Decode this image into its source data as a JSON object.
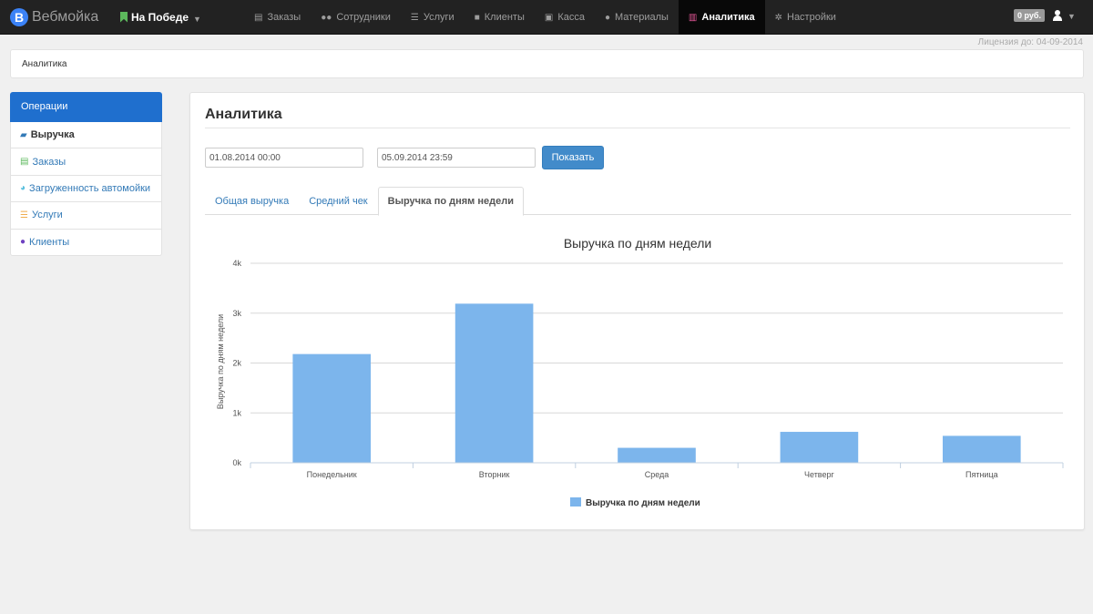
{
  "app": {
    "brand_letter": "В",
    "brand_name": "Вебмойка",
    "location": "На Победе",
    "balance": "0 руб.",
    "license": "Лицензия до: 04-09-2014"
  },
  "nav": {
    "items": [
      {
        "label": "Заказы",
        "icon": "book-icon"
      },
      {
        "label": "Сотрудники",
        "icon": "users-icon"
      },
      {
        "label": "Услуги",
        "icon": "list-icon"
      },
      {
        "label": "Клиенты",
        "icon": "truck-icon"
      },
      {
        "label": "Касса",
        "icon": "cash-icon"
      },
      {
        "label": "Материалы",
        "icon": "drop-icon"
      },
      {
        "label": "Аналитика",
        "icon": "chart-icon",
        "active": true
      },
      {
        "label": "Настройки",
        "icon": "gear-icon"
      }
    ]
  },
  "breadcrumb": "Аналитика",
  "sidebar": {
    "title": "Операции",
    "items": [
      {
        "label": "Выручка",
        "icon": "briefcase-icon",
        "active": true
      },
      {
        "label": "Заказы",
        "icon": "book-icon"
      },
      {
        "label": "Загруженность автомойки",
        "icon": "dashboard-icon"
      },
      {
        "label": "Услуги",
        "icon": "list-icon"
      },
      {
        "label": "Клиенты",
        "icon": "user-icon"
      }
    ]
  },
  "main": {
    "title": "Аналитика",
    "date_from": "01.08.2014 00:00",
    "date_to": "05.09.2014 23:59",
    "show_label": "Показать",
    "tabs": [
      {
        "label": "Общая выручка"
      },
      {
        "label": "Средний чек"
      },
      {
        "label": "Выручка по дням недели",
        "active": true
      }
    ]
  },
  "colors": {
    "accent": "#1f6fce",
    "bar": "#7cb5ec",
    "navbar": "#222222"
  },
  "chart_data": {
    "type": "bar",
    "title": "Выручка по дням недели",
    "ylabel": "Выручка по дням недели",
    "categories": [
      "Понедельник",
      "Вторник",
      "Среда",
      "Четверг",
      "Пятница"
    ],
    "series": [
      {
        "name": "Выручка по дням недели",
        "values": [
          2180,
          3190,
          300,
          620,
          540
        ]
      }
    ],
    "ylim": [
      0,
      4000
    ],
    "yticks": [
      {
        "value": 0,
        "label": "0k"
      },
      {
        "value": 1000,
        "label": "1k"
      },
      {
        "value": 2000,
        "label": "2k"
      },
      {
        "value": 3000,
        "label": "3k"
      },
      {
        "value": 4000,
        "label": "4k"
      }
    ],
    "grid": true,
    "legend": "bottom-center"
  }
}
